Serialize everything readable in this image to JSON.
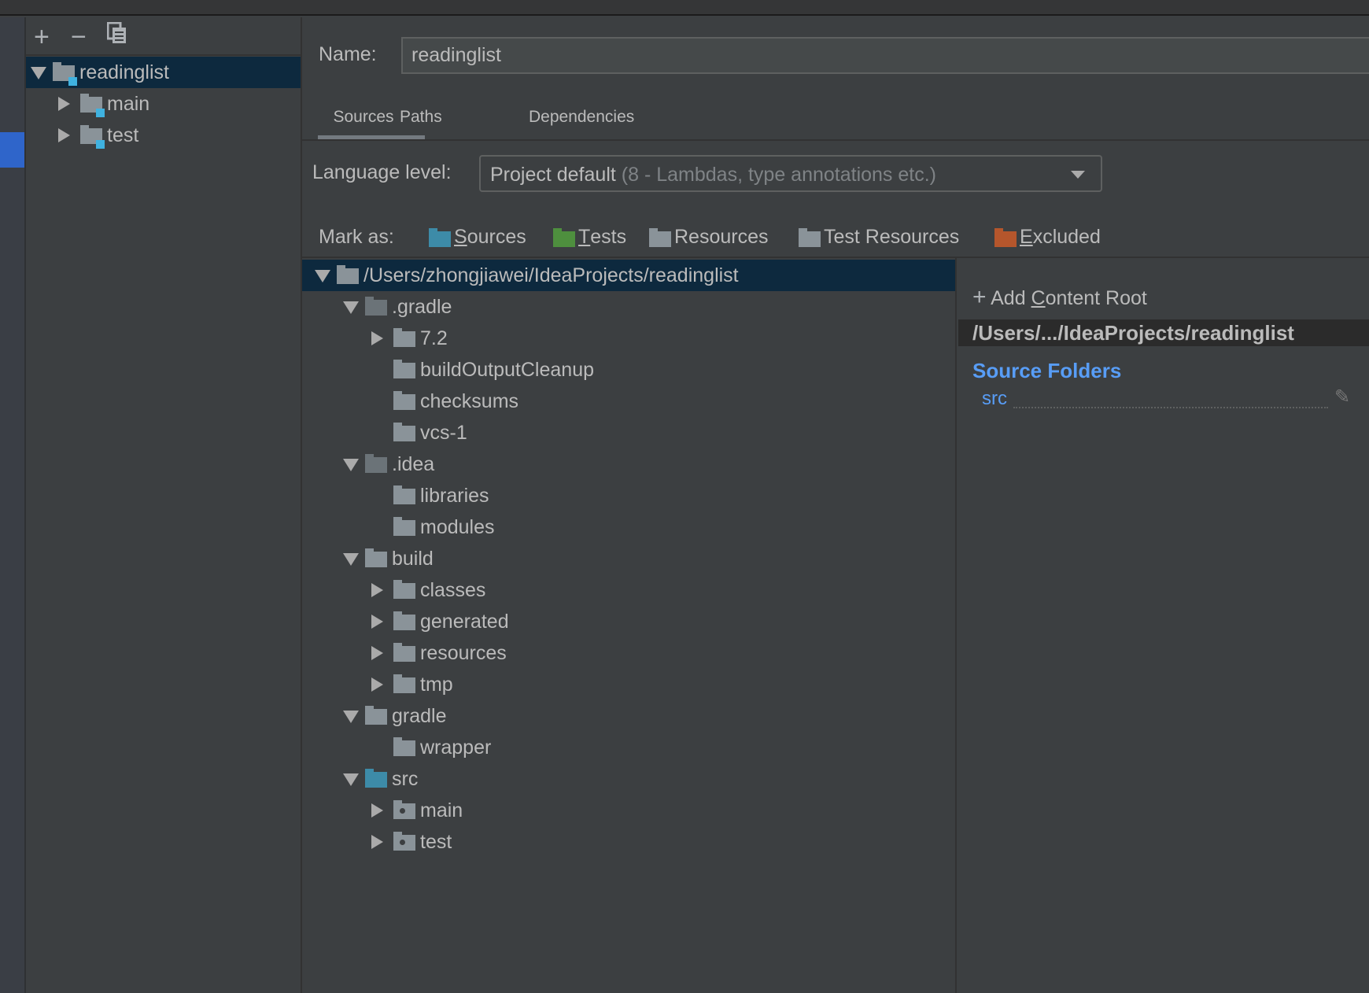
{
  "sidebar": {
    "toolbar": {
      "add": "+",
      "remove": "−",
      "copy_icon": "copy-icon"
    },
    "modules": [
      {
        "label": "readinglist",
        "level": 0,
        "expanded": true,
        "selected": true
      },
      {
        "label": "main",
        "level": 1,
        "expanded": false
      },
      {
        "label": "test",
        "level": 1,
        "expanded": false
      }
    ]
  },
  "form": {
    "name_label": "Name:",
    "name_value": "readinglist",
    "tabs": [
      "Sources",
      "Paths",
      "Dependencies"
    ],
    "active_tab": "Sources",
    "language_level_label": "Language level:",
    "language_level_value": "Project default",
    "language_level_hint": "(8 - Lambdas, type annotations etc.)",
    "mark_as_label": "Mark as:",
    "mark_as": [
      {
        "first": "S",
        "rest": "ources",
        "color": "#3d8ba8"
      },
      {
        "first": "T",
        "rest": "ests",
        "color": "#4e8f3e"
      },
      {
        "first": "",
        "rest": "Resources",
        "color": "#8a9399"
      },
      {
        "first": "",
        "rest": "Test Resources",
        "color": "#8a9399"
      },
      {
        "first": "E",
        "rest": "xcluded",
        "color": "#b5562c"
      }
    ]
  },
  "tree": [
    {
      "label": "/Users/zhongjiawei/IdeaProjects/readinglist",
      "level": 0,
      "arrow": "down",
      "selected": true,
      "color": "#8a9399"
    },
    {
      "label": ".gradle",
      "level": 1,
      "arrow": "down",
      "color": "#6b7378"
    },
    {
      "label": "7.2",
      "level": 2,
      "arrow": "right",
      "color": "#8a9399"
    },
    {
      "label": "buildOutputCleanup",
      "level": 2,
      "arrow": "",
      "color": "#8a9399"
    },
    {
      "label": "checksums",
      "level": 2,
      "arrow": "",
      "color": "#8a9399"
    },
    {
      "label": "vcs-1",
      "level": 2,
      "arrow": "",
      "color": "#8a9399"
    },
    {
      "label": ".idea",
      "level": 1,
      "arrow": "down",
      "color": "#6b7378"
    },
    {
      "label": "libraries",
      "level": 2,
      "arrow": "",
      "color": "#8a9399"
    },
    {
      "label": "modules",
      "level": 2,
      "arrow": "",
      "color": "#8a9399"
    },
    {
      "label": "build",
      "level": 1,
      "arrow": "down",
      "color": "#8a9399"
    },
    {
      "label": "classes",
      "level": 2,
      "arrow": "right",
      "color": "#8a9399"
    },
    {
      "label": "generated",
      "level": 2,
      "arrow": "right",
      "color": "#8a9399"
    },
    {
      "label": "resources",
      "level": 2,
      "arrow": "right",
      "color": "#8a9399"
    },
    {
      "label": "tmp",
      "level": 2,
      "arrow": "right",
      "color": "#8a9399"
    },
    {
      "label": "gradle",
      "level": 1,
      "arrow": "down",
      "color": "#8a9399"
    },
    {
      "label": "wrapper",
      "level": 2,
      "arrow": "",
      "color": "#8a9399"
    },
    {
      "label": "src",
      "level": 1,
      "arrow": "down",
      "color": "#3d8ba8"
    },
    {
      "label": "main",
      "level": 2,
      "arrow": "right",
      "color": "#8a9399",
      "dot": true
    },
    {
      "label": "test",
      "level": 2,
      "arrow": "right",
      "color": "#8a9399",
      "dot": true
    }
  ],
  "roots": {
    "add_first": "Add ",
    "add_mnemonic": "C",
    "add_rest": "ontent Root",
    "root_path": "/Users/.../IdeaProjects/readinglist",
    "source_folders_title": "Source Folders",
    "source_folders": [
      "src"
    ]
  }
}
